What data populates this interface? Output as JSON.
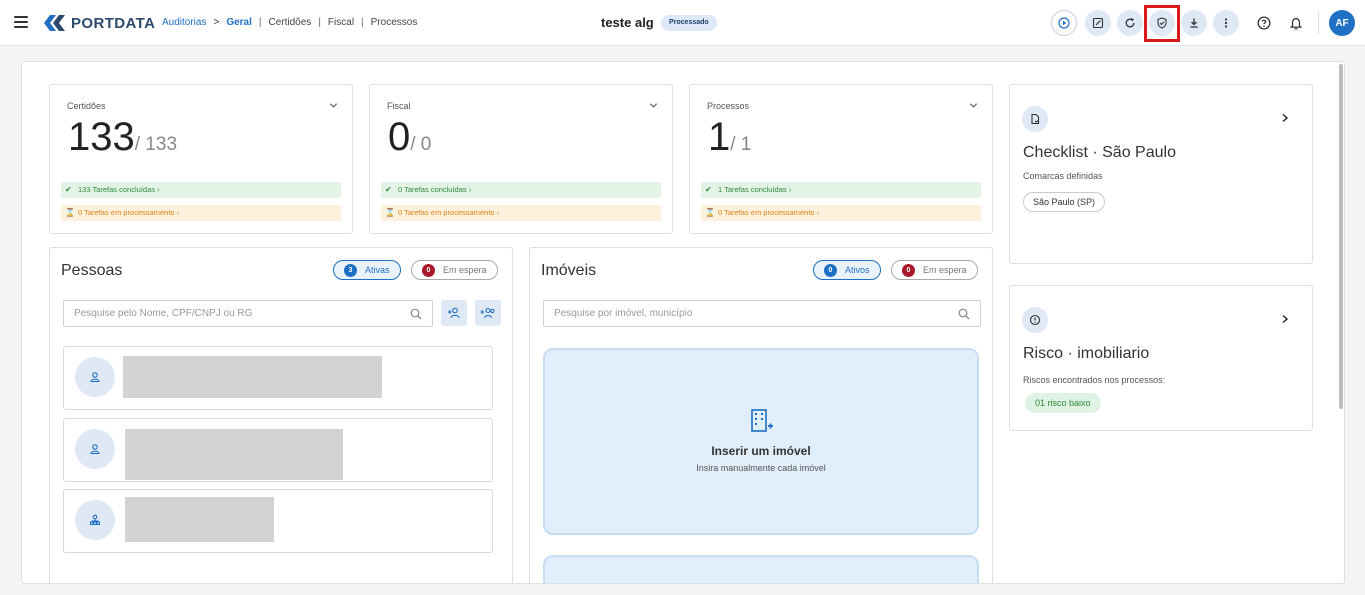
{
  "header": {
    "logo_text": "PORTDATA",
    "breadcrumb": {
      "root": "Auditorias",
      "separator": ">",
      "active": "Geral",
      "divider": "|",
      "items": [
        "Certidões",
        "Fiscal",
        "Processos"
      ]
    },
    "title": "teste alg",
    "status": "Processado",
    "toolbar_icons": [
      "play-icon",
      "edit-icon",
      "refresh-icon",
      "shield-check-icon",
      "download-icon",
      "more-vertical-icon",
      "help-icon",
      "bell-icon"
    ],
    "avatar_initials": "AF"
  },
  "stats": [
    {
      "label": "Certidões",
      "value": "133",
      "total": "/ 133",
      "done": "133 Tarefas concluídas",
      "processing": "0 Tarefas em processamento"
    },
    {
      "label": "Fiscal",
      "value": "0",
      "total": "/ 0",
      "done": "0 Tarefas concluídas",
      "processing": "0 Tarefas em processamento"
    },
    {
      "label": "Processos",
      "value": "1",
      "total": "/ 1",
      "done": "1 Tarefas concluídas",
      "processing": "0 Tarefas em processamento"
    }
  ],
  "pessoas": {
    "title": "Pessoas",
    "ativas_count": "3",
    "ativas_label": "Ativas",
    "espera_count": "0",
    "espera_label": "Em espera",
    "search_placeholder": "Pesquise pelo Nome, CPF/CNPJ ou RG"
  },
  "imoveis": {
    "title": "Imóveis",
    "ativos_count": "0",
    "ativos_label": "Ativos",
    "espera_count": "0",
    "espera_label": "Em espera",
    "search_placeholder": "Pesquise por imóvel, município",
    "insert_title": "Inserir um imóvel",
    "insert_subtitle": "Insira manualmente cada imóvel"
  },
  "checklist": {
    "title": "Checklist · São Paulo",
    "subtitle": "Comarcas definidas",
    "chip": "São Paulo (SP)"
  },
  "risco": {
    "title": "Risco · imobiliario",
    "subtitle": "Riscos encontrados nos processos:",
    "chip": "01 risco baixo"
  },
  "colors": {
    "accent": "#1f6fc4",
    "done": "#2e8a3a",
    "processing": "#d88512",
    "highlight": "#d91a1a"
  }
}
